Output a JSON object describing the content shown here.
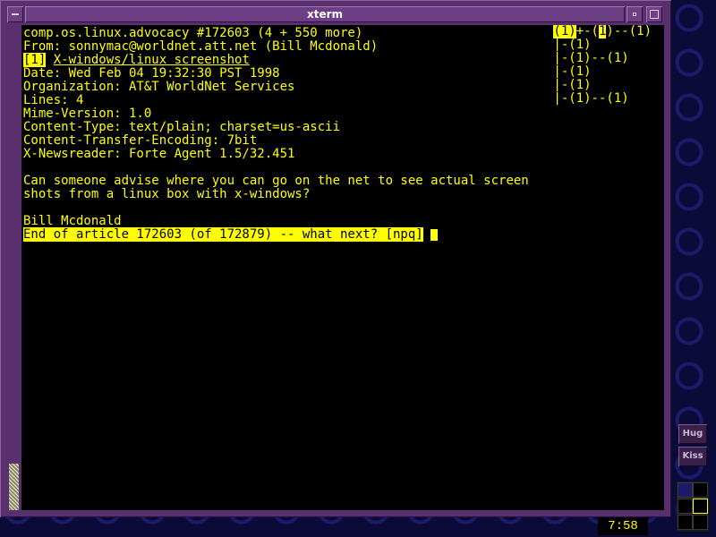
{
  "window": {
    "title": "xterm"
  },
  "article": {
    "header_line": "comp.os.linux.advocacy #172603 (4 + 550 more)",
    "from": "From: sonnymac@worldnet.att.net (Bill Mcdonald)",
    "subject_index": "[1]",
    "subject": "X-windows/linux screenshot",
    "date": "Date: Wed Feb 04 19:32:30 PST 1998",
    "organization": "Organization: AT&T WorldNet Services",
    "lines": "Lines: 4",
    "mime_version": "Mime-Version: 1.0",
    "content_type": "Content-Type: text/plain; charset=us-ascii",
    "content_transfer_encoding": "Content-Transfer-Encoding: 7bit",
    "x_newsreader": "X-Newsreader: Forte Agent 1.5/32.451",
    "body_line_1": "Can someone advise where you can go on the net to see actual screen",
    "body_line_2": "shots from a linux box with x-windows?",
    "signature": "Bill Mcdonald",
    "prompt": "End of article 172603 (of 172879) -- what next? [npq]"
  },
  "thread_tree": {
    "line_1_current": "(1)",
    "line_1_mid": "+-(",
    "line_1_marker": "1",
    "line_1_rest": ")--(1)",
    "line_2": "|-(1)",
    "line_3": "|-(1)--(1)",
    "line_4": "|-(1)",
    "line_5": "|-(1)",
    "line_6": "|-(1)--(1)"
  },
  "side_buttons": {
    "hug": "Hug",
    "kiss": "Kiss"
  },
  "clock": {
    "time": "7:58"
  },
  "colors": {
    "terminal_fg": "#ffff00",
    "terminal_bg": "#000000",
    "frame": "#5a2f6d",
    "desktop": "#0b0b3a"
  }
}
